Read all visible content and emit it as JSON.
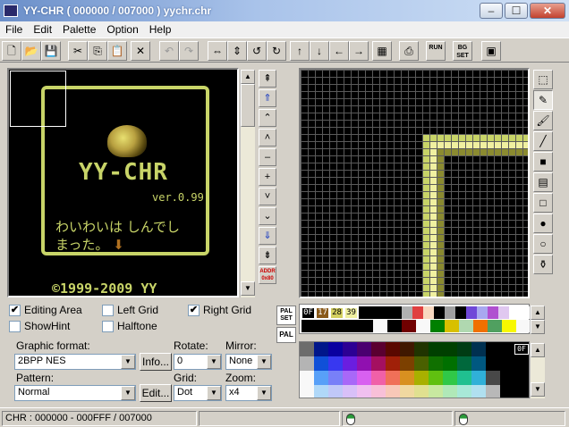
{
  "window": {
    "title": "YY-CHR ( 000000 / 007000 ) yychr.chr",
    "minimize_glyph": "–",
    "maximize_glyph": "☐",
    "close_glyph": "✕"
  },
  "menu": [
    "File",
    "Edit",
    "Palette",
    "Option",
    "Help"
  ],
  "toolbar": [
    {
      "name": "new-icon",
      "glyph": "🗋"
    },
    {
      "name": "open-icon",
      "glyph": "📂"
    },
    {
      "name": "save-icon",
      "glyph": "💾"
    },
    {
      "name": "cut-icon",
      "glyph": "✂"
    },
    {
      "name": "copy-icon",
      "glyph": "⎘"
    },
    {
      "name": "paste-icon",
      "glyph": "📋"
    },
    {
      "name": "clear-icon",
      "glyph": "✕"
    },
    {
      "name": "undo-icon",
      "glyph": "↶"
    },
    {
      "name": "redo-icon",
      "glyph": "↷"
    },
    {
      "name": "flip-horizontal-icon",
      "glyph": "⇔"
    },
    {
      "name": "flip-vertical-icon",
      "glyph": "⇕"
    },
    {
      "name": "rotate-left-icon",
      "glyph": "↺"
    },
    {
      "name": "rotate-right-icon",
      "glyph": "↻"
    },
    {
      "name": "shift-up-icon",
      "glyph": "↑"
    },
    {
      "name": "shift-down-icon",
      "glyph": "↓"
    },
    {
      "name": "shift-left-icon",
      "glyph": "←"
    },
    {
      "name": "shift-right-icon",
      "glyph": "→"
    },
    {
      "name": "palette-edit-icon",
      "glyph": "▦"
    },
    {
      "name": "bookmark-icon",
      "glyph": "⎙"
    },
    {
      "name": "run-icon",
      "glyph": "RUN"
    },
    {
      "name": "bg-set-icon",
      "glyph": "BG SET"
    },
    {
      "name": "export-icon",
      "glyph": "▣"
    }
  ],
  "nav_buttons": [
    {
      "name": "scroll-top-button",
      "glyph": "⇞",
      "blue": false
    },
    {
      "name": "page-up-fast-button",
      "glyph": "⇑",
      "blue": true
    },
    {
      "name": "page-up-button",
      "glyph": "⌃",
      "blue": false
    },
    {
      "name": "line-up-button",
      "glyph": "˄",
      "blue": false
    },
    {
      "name": "minus-button",
      "glyph": "–",
      "blue": false
    },
    {
      "name": "plus-button",
      "glyph": "+",
      "blue": false
    },
    {
      "name": "line-down-button",
      "glyph": "˅",
      "blue": false
    },
    {
      "name": "page-down-button",
      "glyph": "⌄",
      "blue": false
    },
    {
      "name": "page-down-fast-button",
      "glyph": "⇓",
      "blue": true
    },
    {
      "name": "scroll-bottom-button",
      "glyph": "⇟",
      "blue": false
    },
    {
      "name": "address-button",
      "glyph": "ADDR 0x80",
      "blue": false
    }
  ],
  "tools": [
    {
      "name": "select-tool-icon",
      "glyph": "⬚"
    },
    {
      "name": "pen-tool-icon",
      "glyph": "✎"
    },
    {
      "name": "brush-tool-icon",
      "glyph": "🖌"
    },
    {
      "name": "line-tool-icon",
      "glyph": "╱"
    },
    {
      "name": "filled-rect-tool-icon",
      "glyph": "■"
    },
    {
      "name": "pattern-fill-tool-icon",
      "glyph": "▤"
    },
    {
      "name": "rect-tool-icon",
      "glyph": "□"
    },
    {
      "name": "filled-circle-tool-icon",
      "glyph": "●"
    },
    {
      "name": "circle-tool-icon",
      "glyph": "○"
    },
    {
      "name": "fill-bucket-tool-icon",
      "glyph": "⚱"
    }
  ],
  "preview": {
    "logo": "YY-CHR",
    "version": "ver.0.99",
    "message": "わいわいは しんでしまった。",
    "arrow": "⬇",
    "copyright": "©1999-2009 YY",
    "frame_color": "#c8d468"
  },
  "options": {
    "editing_area": "Editing Area",
    "editing_area_checked": "✔",
    "left_grid": "Left Grid",
    "right_grid": "Right Grid",
    "right_grid_checked": "✔",
    "show_hint": "ShowHint",
    "halftone": "Halftone"
  },
  "form": {
    "graphic_format_label": "Graphic format:",
    "graphic_format_value": "2BPP NES",
    "info_button": "Info...",
    "rotate_label": "Rotate:",
    "rotate_value": "0",
    "mirror_label": "Mirror:",
    "mirror_value": "None",
    "pattern_label": "Pattern:",
    "pattern_value": "Normal",
    "edit_button": "Edit...",
    "grid_label": "Grid:",
    "grid_value": "Dot",
    "zoom_label": "Zoom:",
    "zoom_value": "x4"
  },
  "palette": {
    "pal_set_label": "PAL SET",
    "pal_label": "PAL",
    "selected_codes": [
      "0F",
      "17",
      "28",
      "39"
    ],
    "selected_colors": [
      "#000000",
      "#8a5a1a",
      "#d4d060",
      "#f0f0a0"
    ],
    "picker_tag": "0F",
    "row1": [
      "#000000",
      "#000000",
      "#000000",
      "#000000",
      "#b0b0b0",
      "#e04040",
      "#f8d8c0",
      "#000000",
      "#a0a0a0",
      "#000000",
      "#7048d8",
      "#a8a8f0",
      "#b050d0",
      "#e0c8f0",
      "#ffffff",
      "#ffffff"
    ],
    "row2": [
      "#000000",
      "#000000",
      "#000000",
      "#000000",
      "#000000",
      "#f8f8f8",
      "#000000",
      "#700000",
      "#f8f8f8",
      "#008000",
      "#d8c000",
      "#b0d8b0",
      "#f07000",
      "#50a060",
      "#f8f800",
      "#f8f8f8"
    ]
  },
  "picker_rows": [
    [
      "#6c6c6c",
      "#00168a",
      "#0a00a0",
      "#2c0094",
      "#4a0070",
      "#5a0030",
      "#5a0800",
      "#401800",
      "#203400",
      "#004000",
      "#004000",
      "#003c14",
      "#003050",
      "#000000",
      "#000000",
      "#000000"
    ],
    [
      "#b4b4b4",
      "#1050d8",
      "#3838f0",
      "#6a1ee0",
      "#9010b0",
      "#a41060",
      "#a02008",
      "#7c4000",
      "#4a6000",
      "#107000",
      "#007000",
      "#00683c",
      "#005880",
      "#000000",
      "#000000",
      "#000000"
    ],
    [
      "#f8f8f8",
      "#58a0f8",
      "#7880f8",
      "#a868f8",
      "#d860f0",
      "#f060a8",
      "#f07058",
      "#d89020",
      "#a8b000",
      "#60c010",
      "#30c848",
      "#20c090",
      "#30b0d8",
      "#484848",
      "#000000",
      "#000000"
    ],
    [
      "#f8f8f8",
      "#b0d8f8",
      "#c0c8f8",
      "#d8c0f8",
      "#f0c0f0",
      "#f8c0d8",
      "#f8c8b8",
      "#f0d8a0",
      "#e0e090",
      "#c8e8a0",
      "#b0e8b8",
      "#a8e8d8",
      "#b0e0f0",
      "#b8b8b8",
      "#000000",
      "#000000"
    ]
  ],
  "status": {
    "chr_info": "CHR : 000000 - 000FFF / 007000"
  }
}
